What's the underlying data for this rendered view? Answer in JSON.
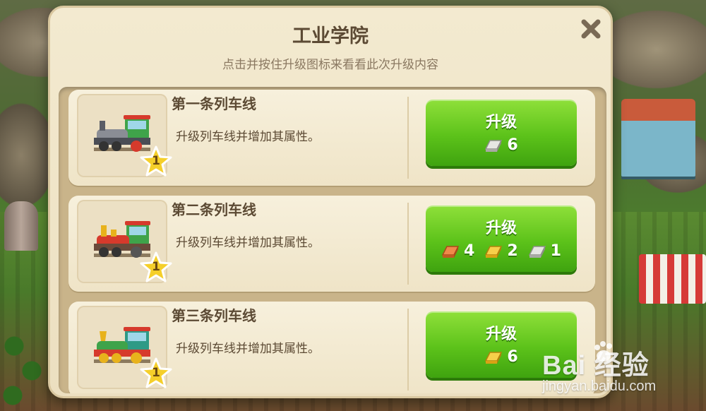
{
  "dialog": {
    "title": "工业学院",
    "subtitle": "点击并按住升级图标来看看此次升级内容"
  },
  "items": [
    {
      "title": "第一条列车线",
      "description": "升级列车线并增加其属性。",
      "level": "1",
      "button_label": "升级",
      "costs": [
        {
          "material": "silver",
          "amount": "6"
        }
      ]
    },
    {
      "title": "第二条列车线",
      "description": "升级列车线并增加其属性。",
      "level": "1",
      "button_label": "升级",
      "costs": [
        {
          "material": "copper",
          "amount": "4"
        },
        {
          "material": "gold",
          "amount": "2"
        },
        {
          "material": "silver",
          "amount": "1"
        }
      ]
    },
    {
      "title": "第三条列车线",
      "description": "升级列车线并增加其属性。",
      "level": "1",
      "button_label": "升级",
      "costs": [
        {
          "material": "gold",
          "amount": "6"
        }
      ]
    }
  ],
  "watermark": {
    "logo_text": "Bai  经验",
    "url": "jingyan.baidu.com"
  },
  "colors": {
    "button_green": "#5cc21a",
    "panel_cream": "#f3ead0",
    "text_brown": "#5c4a34",
    "star_yellow": "#f5cf2a",
    "copper": "#d66a2c",
    "gold": "#e8b21c",
    "silver": "#c9c9c4"
  }
}
